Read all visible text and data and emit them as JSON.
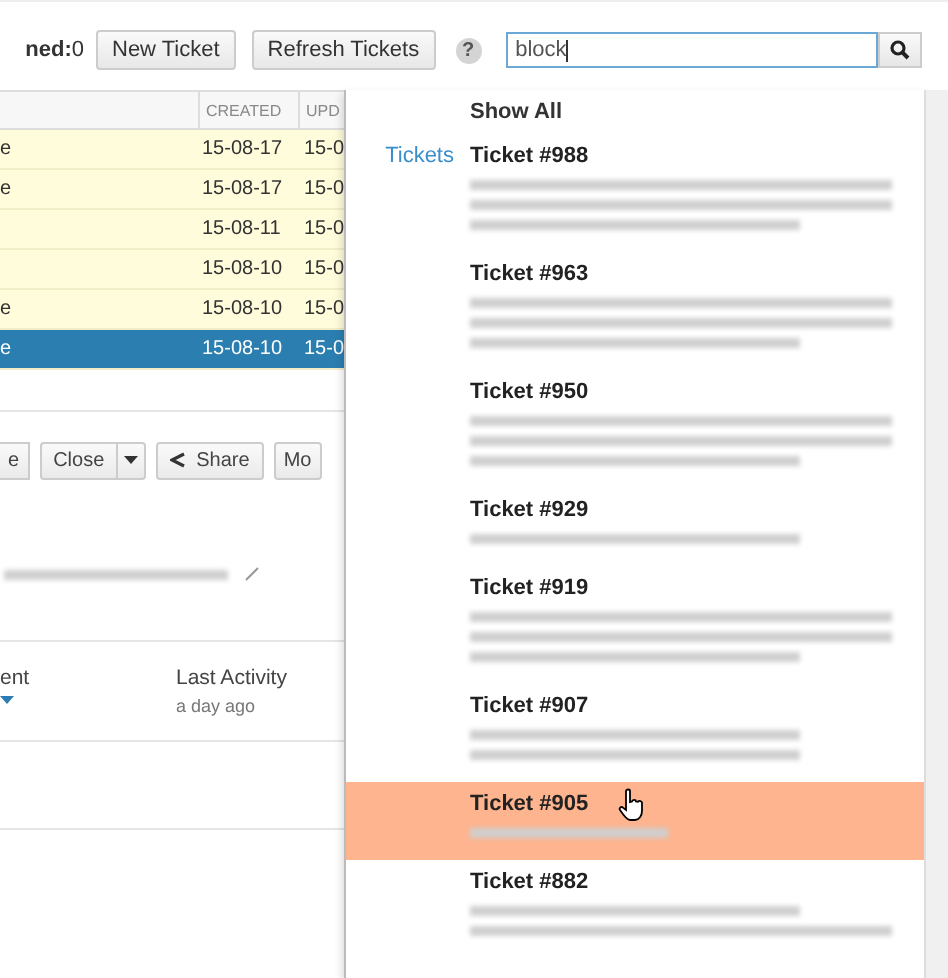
{
  "toolbar": {
    "counter": "**ned:**0",
    "buttons": [
      "New Ticket",
      "Refresh Tickets"
    ],
    "help": "?",
    "search": {
      "value": "block"
    }
  },
  "table": {
    "columns": [
      "CREATED",
      "UPD"
    ],
    "rows": [
      {
        "column_1": "e",
        "created": "15-08-17",
        "updated": "15-0",
        "selected": false
      },
      {
        "column_1": "e",
        "created": "15-08-17",
        "updated": "15-0",
        "selected": false
      },
      {
        "column_1": "",
        "created": "15-08-11",
        "updated": "15-0",
        "selected": false
      },
      {
        "column_1": "",
        "created": "15-08-10",
        "updated": "15-0",
        "selected": false
      },
      {
        "column_1": "e",
        "created": "15-08-10",
        "updated": "15-0",
        "selected": false
      },
      {
        "column_1": "e",
        "created": "15-08-10",
        "updated": "15-0",
        "selected": true
      }
    ]
  },
  "actions": [
    {
      "kind": "button",
      "label": "e"
    },
    {
      "kind": "split",
      "label": "Close"
    },
    {
      "kind": "share",
      "label": "Share"
    },
    {
      "kind": "button",
      "label": "Mo"
    }
  ],
  "details": {
    "summary": [
      {
        "kind": "full"
      }
    ],
    "fields": [
      {
        "label": "ent",
        "kind": "dropdown"
      },
      {
        "label": "Last Activity",
        "value": "a day ago",
        "kind": "text"
      }
    ]
  },
  "dropdown": {
    "show_all": "Show All",
    "group": "Tickets",
    "results": [
      {
        "title": "Ticket #988",
        "snippet": [
          {
            "kind": "full"
          },
          {
            "kind": "full"
          },
          {
            "kind": "partial"
          }
        ],
        "hovered": false
      },
      {
        "title": "Ticket #963",
        "snippet": [
          {
            "kind": "full"
          },
          {
            "kind": "full"
          },
          {
            "kind": "partial"
          }
        ],
        "hovered": false
      },
      {
        "title": "Ticket #950",
        "snippet": [
          {
            "kind": "full"
          },
          {
            "kind": "full"
          },
          {
            "kind": "partial"
          }
        ],
        "hovered": false
      },
      {
        "title": "Ticket #929",
        "snippet": [
          {
            "kind": "partial"
          }
        ],
        "hovered": false
      },
      {
        "title": "Ticket #919",
        "snippet": [
          {
            "kind": "full"
          },
          {
            "kind": "full"
          },
          {
            "kind": "partial"
          }
        ],
        "hovered": false
      },
      {
        "title": "Ticket #907",
        "snippet": [
          {
            "kind": "partial"
          },
          {
            "kind": "partial"
          }
        ],
        "hovered": false
      },
      {
        "title": "Ticket #905",
        "snippet": [
          {
            "kind": "short"
          }
        ],
        "hovered": true
      },
      {
        "title": "Ticket #882",
        "snippet": [
          {
            "kind": "partial"
          },
          {
            "kind": "full"
          }
        ],
        "hovered": false
      }
    ]
  }
}
